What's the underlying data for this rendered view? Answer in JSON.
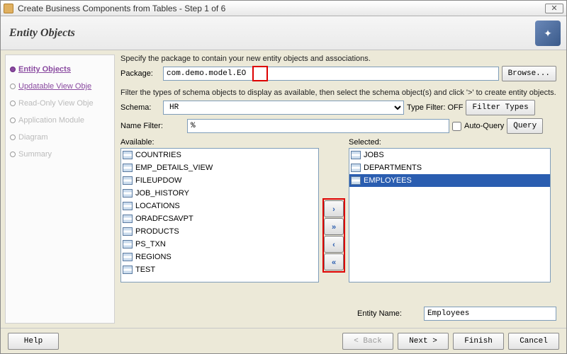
{
  "window": {
    "title": "Create Business Components from Tables - Step 1 of 6"
  },
  "header": {
    "title": "Entity Objects"
  },
  "wizard": {
    "steps": [
      {
        "label": "Entity Objects",
        "state": "current"
      },
      {
        "label": "Updatable View Obje",
        "state": "visited"
      },
      {
        "label": "Read-Only View Obje",
        "state": "pending"
      },
      {
        "label": "Application Module",
        "state": "pending"
      },
      {
        "label": "Diagram",
        "state": "pending"
      },
      {
        "label": "Summary",
        "state": "pending"
      }
    ]
  },
  "instructions": {
    "line1": "Specify the package to contain your new entity objects and associations.",
    "line2": "Filter the types of schema objects to display as available, then select the schema object(s) and click '>' to create entity objects."
  },
  "package": {
    "label": "Package:",
    "value": "com.demo.model.EO",
    "browse": "Browse..."
  },
  "schema": {
    "label": "Schema:",
    "value": "HR",
    "typeFilterLabel": "Type Filter:",
    "typeFilterState": "OFF",
    "filterBtn": "Filter Types"
  },
  "nameFilter": {
    "label": "Name Filter:",
    "value": "%",
    "autoQuery": "Auto-Query",
    "queryBtn": "Query"
  },
  "available": {
    "label": "Available:",
    "items": [
      "COUNTRIES",
      "EMP_DETAILS_VIEW",
      "FILEUPDOW",
      "JOB_HISTORY",
      "LOCATIONS",
      "ORADFCSAVPT",
      "PRODUCTS",
      "PS_TXN",
      "REGIONS",
      "TEST"
    ]
  },
  "selected": {
    "label": "Selected:",
    "items": [
      {
        "name": "JOBS",
        "sel": false
      },
      {
        "name": "DEPARTMENTS",
        "sel": false
      },
      {
        "name": "EMPLOYEES",
        "sel": true
      }
    ]
  },
  "shuttle": {
    "right": "›",
    "rightAll": "»",
    "left": "‹",
    "leftAll": "«"
  },
  "entityName": {
    "label": "Entity Name:",
    "value": "Employees"
  },
  "footer": {
    "help": "Help",
    "back": "< Back",
    "next": "Next >",
    "finish": "Finish",
    "cancel": "Cancel"
  }
}
